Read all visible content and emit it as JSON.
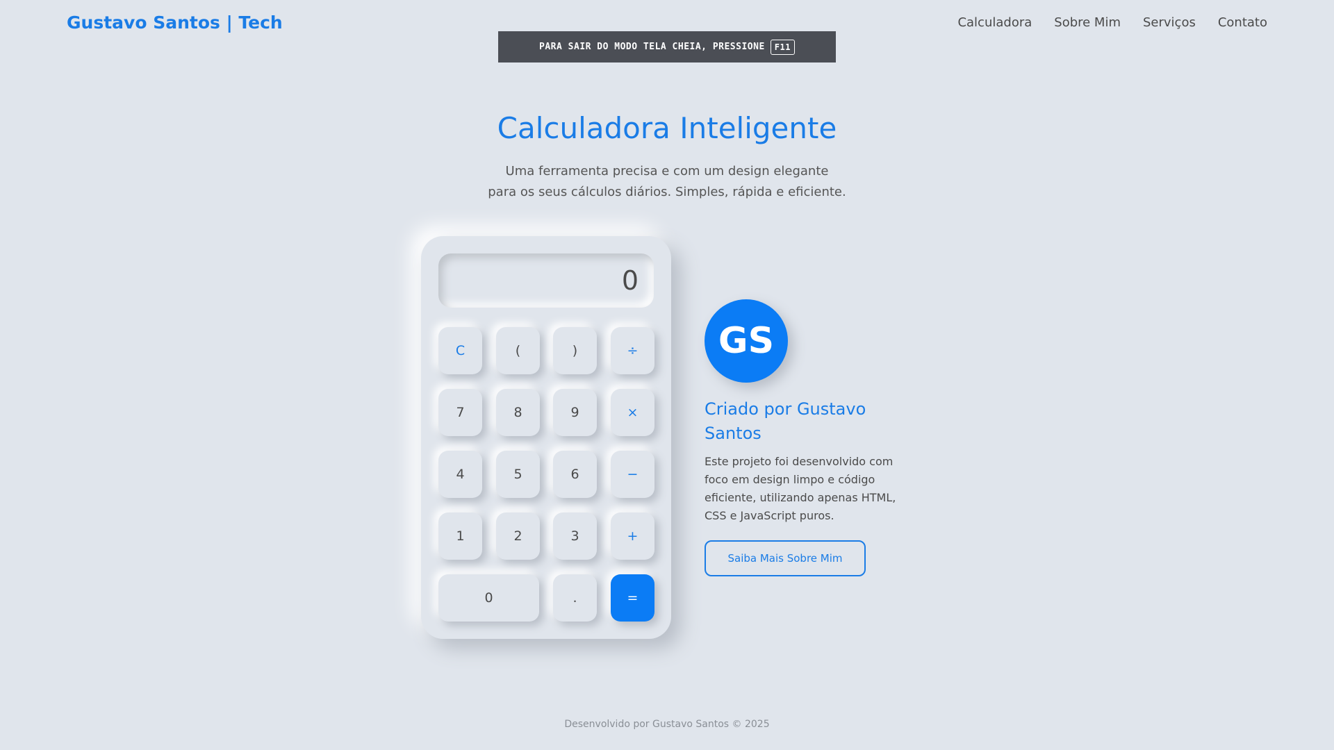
{
  "header": {
    "brand": "Gustavo Santos | Tech",
    "nav": [
      "Calculadora",
      "Sobre Mim",
      "Serviços",
      "Contato"
    ]
  },
  "fullscreen_notice": {
    "text": "PARA SAIR DO MODO TELA CHEIA, PRESSIONE",
    "key": "F11"
  },
  "hero": {
    "title": "Calculadora Inteligente",
    "subtitle_line1": "Uma ferramenta precisa e com um design elegante",
    "subtitle_line2": "para os seus cálculos diários. Simples, rápida e eficiente."
  },
  "calculator": {
    "display": "0",
    "keys": [
      "C",
      "(",
      ")",
      "÷",
      "7",
      "8",
      "9",
      "×",
      "4",
      "5",
      "6",
      "−",
      "1",
      "2",
      "3",
      "+",
      "0",
      ".",
      "="
    ]
  },
  "creator": {
    "initials": "GS",
    "title": "Criado por Gustavo Santos",
    "description": "Este projeto foi desenvolvido com foco em design limpo e código eficiente, utilizando apenas HTML, CSS e JavaScript puros.",
    "button": "Saiba Mais Sobre Mim"
  },
  "footer": {
    "text": "Desenvolvido por Gustavo Santos © 2025"
  },
  "colors": {
    "accent": "#0b7cf5",
    "background": "#e0e5ec"
  }
}
